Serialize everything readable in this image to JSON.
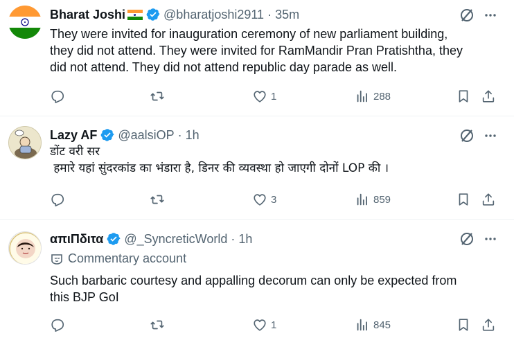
{
  "colors": {
    "accent": "#1d9bf0",
    "muted": "#536471",
    "text": "#0f1419",
    "divider": "#eff3f4"
  },
  "tweets": [
    {
      "name": "Bharat Joshi",
      "has_flag": true,
      "handle": "@bharatjoshi2911",
      "time": "35m",
      "lines": [
        "They were invited for inauguration ceremony of new parliament building,",
        "they did not attend. They were invited for RamMandir Pran Pratishtha,  they",
        "did not attend.  They did not attend republic day parade as well."
      ],
      "likes": "1",
      "views": "288"
    },
    {
      "name": "Lazy AF",
      "handle": "@aalsiOP",
      "time": "1h",
      "lines": [
        "डोंट वरी सर",
        " हमारे यहां सुंदरकांड का भंडारा है, डिनर की व्यवस्था हो जाएगी दोनों LOP की ।"
      ],
      "likes": "3",
      "views": "859"
    },
    {
      "name": "απιΠδιτα",
      "handle": "@_SyncreticWorld",
      "time": "1h",
      "community": "Commentary account",
      "lines": [
        "Such barbaric courtesy and appalling decorum can only be expected from",
        "this BJP GoI"
      ],
      "likes": "1",
      "views": "845"
    }
  ],
  "icons": [
    "reply-icon",
    "retweet-icon",
    "like-icon",
    "views-icon",
    "bookmark-icon",
    "share-icon",
    "grok-icon",
    "more-icon",
    "verified-badge-icon",
    "india-flag-icon",
    "community-notes-icon"
  ]
}
